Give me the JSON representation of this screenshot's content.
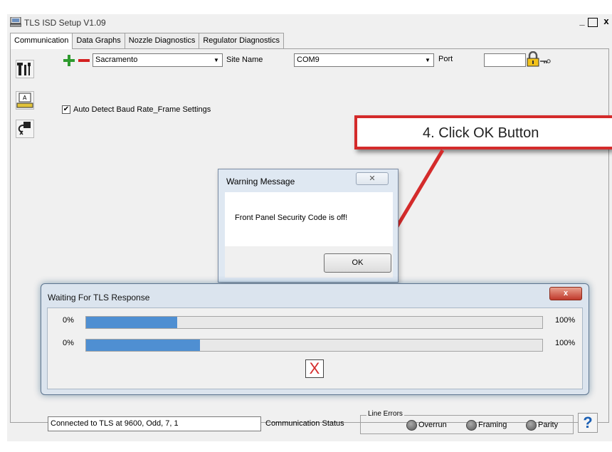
{
  "window": {
    "title": "TLS ISD Setup V1.09",
    "controls": [
      "_",
      "□",
      "x"
    ]
  },
  "tabs": [
    {
      "label": "Communication",
      "active": true
    },
    {
      "label": "Data Graphs",
      "active": false
    },
    {
      "label": "Nozzle Diagnostics",
      "active": false
    },
    {
      "label": "Regulator Diagnostics",
      "active": false
    }
  ],
  "connection": {
    "site_value": "Sacramento",
    "site_label": "Site Name",
    "port_value": "COM9",
    "port_label": "Port",
    "code_value": "",
    "auto_detect_label": "Auto Detect Baud Rate_Frame Settings",
    "auto_detect_checked": true,
    "checkmark": "✔"
  },
  "callout": {
    "text": "4.  Click OK Button",
    "color": "#d42b2b"
  },
  "warning_dialog": {
    "title": "Warning Message",
    "close": "✕",
    "message": "Front Panel Security Code is off!",
    "ok_label": "OK"
  },
  "wait_dialog": {
    "title": "Waiting For TLS Response",
    "close": "x",
    "bars": [
      {
        "start_label": "0%",
        "end_label": "100%",
        "progress": 0.2
      },
      {
        "start_label": "0%",
        "end_label": "100%",
        "progress": 0.25
      }
    ],
    "cancel_glyph": "X"
  },
  "status_bar": {
    "status_text": "Connected to TLS at 9600, Odd, 7, 1",
    "status_label": "Communication Status",
    "line_errors_label": "Line Errors",
    "indicators": [
      "Overrun",
      "Framing",
      "Parity"
    ],
    "help_glyph": "?"
  }
}
